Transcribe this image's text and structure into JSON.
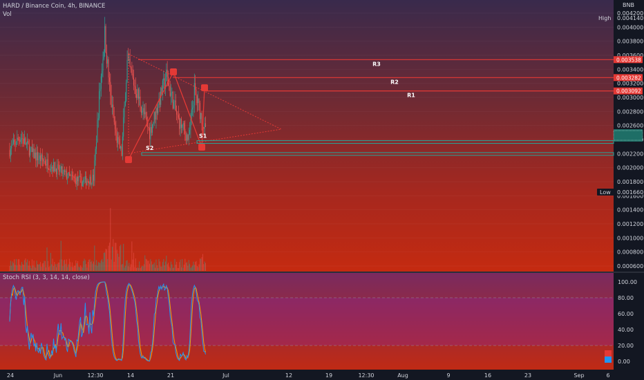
{
  "header": {
    "title": "HARD / Binance Coin, 4h, BINANCE",
    "vol_label": "Vol",
    "quote_currency": "BNB"
  },
  "price_axis": {
    "ticks": [
      "0.004200",
      "0.004000",
      "0.003800",
      "0.003600",
      "0.003400",
      "0.003200",
      "0.003000",
      "0.002800",
      "0.002600",
      "0.002400",
      "0.002200",
      "0.002000",
      "0.001800",
      "0.001600",
      "0.001400",
      "0.001200",
      "0.001000",
      "0.000800",
      "0.000600"
    ],
    "tick_values": [
      0.0042,
      0.004,
      0.0038,
      0.0036,
      0.0034,
      0.0032,
      0.003,
      0.0028,
      0.0026,
      0.0024,
      0.0022,
      0.002,
      0.0018,
      0.0016,
      0.0014,
      0.0012,
      0.001,
      0.0008,
      0.0006
    ],
    "high_label": "High",
    "high_value": "0.004140",
    "low_label": "Low",
    "low_value": "0.001660",
    "tags": [
      {
        "name": "r3-price-tag",
        "text": "0.003538",
        "price": 0.003538,
        "color": "#e53935"
      },
      {
        "name": "r2-price-tag",
        "text": "0.003282",
        "price": 0.003282,
        "color": "#e53935"
      },
      {
        "name": "r1-price-tag",
        "text": "0.003092",
        "price": 0.003092,
        "color": "#e53935"
      }
    ]
  },
  "rsi": {
    "label": "Stoch RSI (3, 3, 14, 14, close)",
    "ticks": [
      "100.00",
      "80.00",
      "60.00",
      "40.00",
      "20.00",
      "0.00"
    ],
    "tick_values": [
      100,
      80,
      60,
      40,
      20,
      0
    ],
    "upper_band": 80,
    "lower_band": 20,
    "k_color": "#2196f3",
    "d_color": "#ff9800"
  },
  "time_axis": [
    "24",
    "Jun",
    "12:30",
    "14",
    "21",
    "Jul",
    "12",
    "19",
    "12:30",
    "Aug",
    "9",
    "16",
    "23",
    "Sep",
    "6"
  ],
  "colors": {
    "up": "#26a69a",
    "down": "#ef5350",
    "resistance": "#e53935",
    "support": "#26a69a",
    "pattern": "#e53935",
    "background_top": "#3b2a4a",
    "background_bottom": "#c62910"
  },
  "chart_data": {
    "type": "candlestick",
    "title": "HARD / Binance Coin, 4h, BINANCE",
    "ylim": [
      0.0005,
      0.0042
    ],
    "high": 0.00414,
    "low": 0.00166,
    "levels": [
      {
        "label": "R3",
        "price": 0.003538
      },
      {
        "label": "R2",
        "price": 0.003282
      },
      {
        "label": "R1",
        "price": 0.003092
      },
      {
        "label": "S1",
        "price": 0.002365
      },
      {
        "label": "S2",
        "price": 0.002195
      }
    ],
    "annotations": {
      "pattern": "descending triangle",
      "pivot_points": [
        0.00213,
        0.00337,
        0.00314,
        0.0023
      ]
    },
    "close_path": [
      [
        "2021-05-24",
        0.00225
      ],
      [
        "2021-05-26",
        0.00245
      ],
      [
        "2021-05-28",
        0.0022
      ],
      [
        "2021-05-31",
        0.00205
      ],
      [
        "2021-06-02",
        0.00195
      ],
      [
        "2021-06-04",
        0.00185
      ],
      [
        "2021-06-06",
        0.0018
      ],
      [
        "2021-06-08",
        0.00185
      ],
      [
        "2021-06-09",
        0.003
      ],
      [
        "2021-06-10",
        0.0039
      ],
      [
        "2021-06-11",
        0.003
      ],
      [
        "2021-06-12",
        0.00245
      ],
      [
        "2021-06-13",
        0.0022
      ],
      [
        "2021-06-14",
        0.0035
      ],
      [
        "2021-06-16",
        0.003
      ],
      [
        "2021-06-18",
        0.0025
      ],
      [
        "2021-06-21",
        0.0033
      ],
      [
        "2021-06-23",
        0.0027
      ],
      [
        "2021-06-25",
        0.0024
      ],
      [
        "2021-06-26",
        0.0031
      ],
      [
        "2021-06-28",
        0.0025
      ]
    ]
  }
}
